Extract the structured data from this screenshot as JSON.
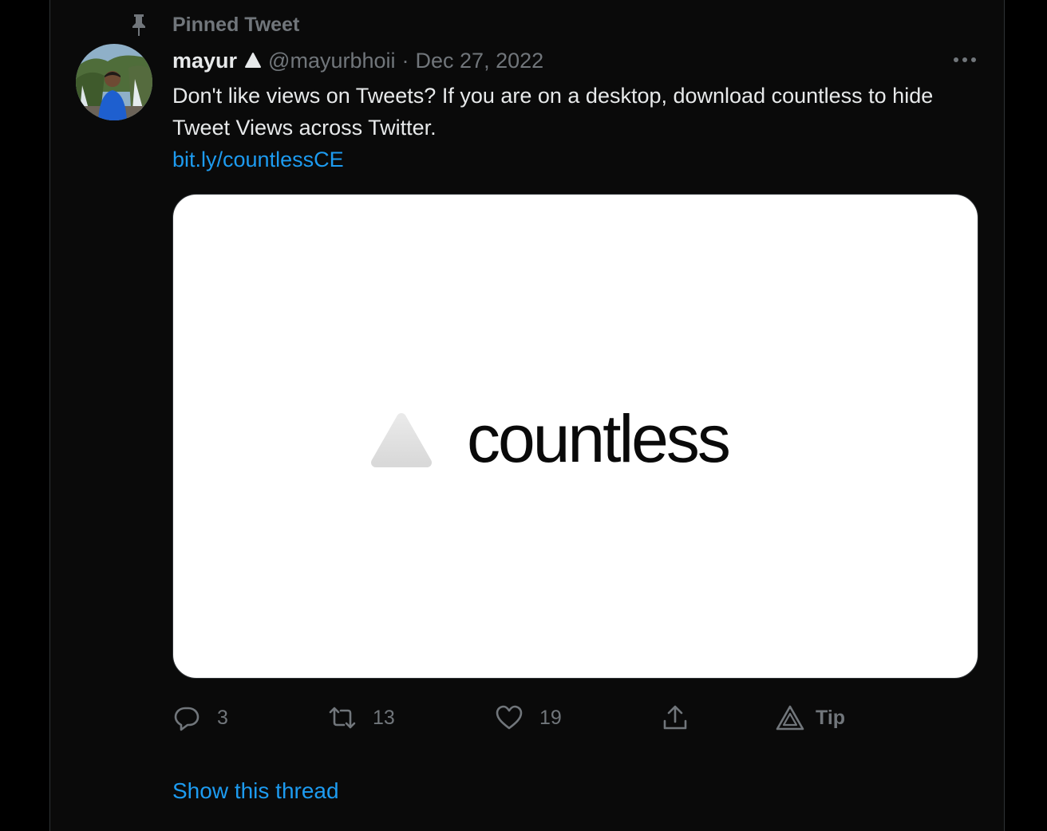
{
  "pinned": {
    "label": "Pinned Tweet",
    "icon": "pin-icon"
  },
  "tweet": {
    "author": {
      "display_name": "mayur",
      "handle": "@mayurbhoii",
      "avatar_icon": "profile-photo"
    },
    "separator": "·",
    "date": "Dec 27, 2022",
    "text": "Don't like views on Tweets? If you are on a desktop, download countless to hide Tweet Views across Twitter.",
    "link": "bit.ly/countlessCE",
    "card": {
      "wordmark": "countless"
    },
    "actions": {
      "reply_count": "3",
      "retweet_count": "13",
      "like_count": "19",
      "tip_label": "Tip"
    },
    "show_thread": "Show this thread"
  },
  "colors": {
    "background": "#000000",
    "text_primary": "#e7e9ea",
    "text_secondary": "#71767b",
    "link": "#1d9bf0"
  }
}
